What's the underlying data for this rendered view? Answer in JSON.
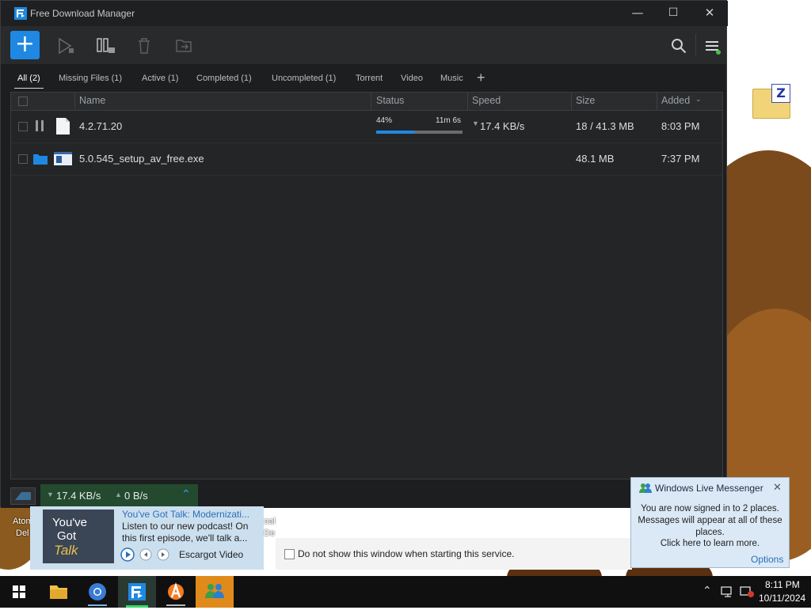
{
  "window": {
    "title": "Free Download Manager",
    "minimize": "—",
    "maximize": "☐",
    "close": "✕"
  },
  "toolbar": {
    "add_label": "+",
    "search": "search-icon",
    "menu": "menu-icon"
  },
  "filters": [
    {
      "label": "All (2)",
      "active": true
    },
    {
      "label": "Missing Files (1)"
    },
    {
      "label": "Active (1)"
    },
    {
      "label": "Completed (1)"
    },
    {
      "label": "Uncompleted (1)"
    },
    {
      "label": "Torrent"
    },
    {
      "label": "Video"
    },
    {
      "label": "Music"
    },
    {
      "label": "+"
    }
  ],
  "columns": {
    "name": "Name",
    "status": "Status",
    "speed": "Speed",
    "size": "Size",
    "added": "Added"
  },
  "downloads": [
    {
      "name": "4.2.71.20",
      "progress_pct": "44%",
      "progress": 0.44,
      "eta": "11m 6s",
      "speed": "17.4 KB/s",
      "size": "18 / 41.3 MB",
      "added": "8:03 PM"
    },
    {
      "name": "5.0.545_setup_av_free.exe",
      "size": "48.1 MB",
      "added": "7:37 PM"
    }
  ],
  "statusbar": {
    "down": "17.4 KB/s",
    "up": "0 B/s"
  },
  "desktop": {
    "icon_label_1a": "Atom",
    "icon_label_1b": "Del",
    "icon_label_2a": "oal",
    "icon_label_2b": "De"
  },
  "avast": {
    "thumb_text_1": "You've",
    "thumb_text_2": "Got",
    "thumb_text_3": "Talk",
    "headline": "You've Got Talk: Modernizati...",
    "body": "Listen to our new podcast! On this first episode, we'll talk a...",
    "source": "Escargot Video"
  },
  "ie_bar": {
    "checkbox_label": "Do not show this window when starting this service."
  },
  "wlm": {
    "title": "Windows Live Messenger",
    "body": "You are now signed in to 2 places. Messages will appear at all of these places.",
    "link": "Click here to learn more.",
    "options": "Options"
  },
  "taskbar": {
    "time": "8:11 PM",
    "date": "10/11/2024"
  },
  "colors": {
    "accent": "#1f88e2",
    "window_bg": "#1d1e20",
    "toolbar_bg": "#292a2c",
    "taskbar_bg": "#101010"
  }
}
